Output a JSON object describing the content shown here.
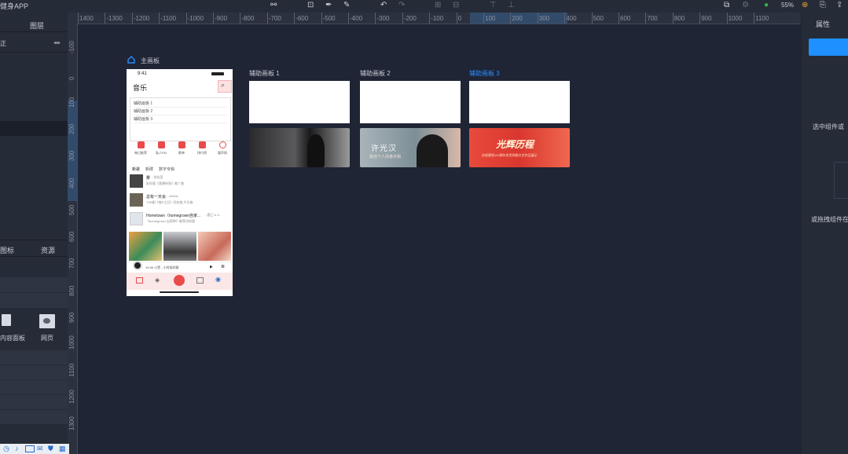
{
  "app": {
    "title": "健身APP"
  },
  "left_panel": {
    "tab_layers": "图层",
    "row_label": "正",
    "tab_icons": "图标",
    "tab_resources": "资源",
    "resource_items": [
      {
        "label": "内容面板",
        "icon": "panel-icon"
      },
      {
        "label": "网页",
        "icon": "webpage-icon"
      }
    ]
  },
  "toolbar": {
    "zoom": "55%"
  },
  "ruler": {
    "h_ticks": [
      "1400",
      "-1300",
      "-1200",
      "-1100",
      "-1000",
      "-900",
      "-800",
      "-700",
      "-600",
      "-500",
      "-400",
      "-300",
      "-200",
      "-100",
      "0",
      "100",
      "200",
      "300",
      "400",
      "500",
      "600",
      "700",
      "800",
      "900",
      "1000",
      "1100"
    ],
    "v_ticks": [
      "-100",
      "0",
      "100",
      "200",
      "300",
      "400",
      "500",
      "600",
      "700",
      "800",
      "900",
      "1000",
      "1100",
      "1200",
      "1300"
    ]
  },
  "main_board": {
    "label": "主画板"
  },
  "artboards": [
    {
      "label": "辅助画板 1",
      "selected": false,
      "banner": "dark-concert"
    },
    {
      "label": "辅助画板 2",
      "selected": false,
      "banner": "hat-portrait"
    },
    {
      "label": "辅助画板 3",
      "selected": true,
      "banner": "red-event"
    }
  ],
  "banners": {
    "b2_title": "许光汉",
    "b2_sub": "最佳个人风格专辑",
    "b3_title": "光辉历程",
    "b3_sub": "庆祝建党100周年优秀网络文艺作品展示"
  },
  "phone": {
    "time": "9:41",
    "title": "音乐",
    "list_items": [
      "辅助画板 1",
      "辅助画板 2",
      "辅助画板 3"
    ],
    "categories": [
      "每日推荐",
      "私人FM",
      "歌单",
      "排行榜",
      "跟声网"
    ],
    "tabs": [
      "新歌",
      "新碟",
      "数字专辑"
    ],
    "songs": [
      {
        "title": "雾",
        "artist": " - 徐佳莹",
        "desc": "彩铃版《我想听到》推广曲"
      },
      {
        "title": "总有一天会",
        "artist": " - Amber",
        "desc": "TVB剧《鬼P之日》同名曲 片头曲"
      },
      {
        "title": "Hometown（homegrown自家...",
        "artist": " - 鹿乙 & 5...",
        "desc": "《homegrown 自家种》推荐试听版"
      }
    ],
    "player_text": "19:36 小黑 - 小时候的歌",
    "colors": {
      "accent": "#e94b4b",
      "brand": "#1f8fff"
    }
  },
  "right_panel": {
    "tab_props": "属性",
    "hint1": "选中组件或",
    "hint2": "或拖拽组件在"
  },
  "colors": {
    "canvas": "#1f2535",
    "panel": "#262b38",
    "selected": "#1e88e5"
  }
}
